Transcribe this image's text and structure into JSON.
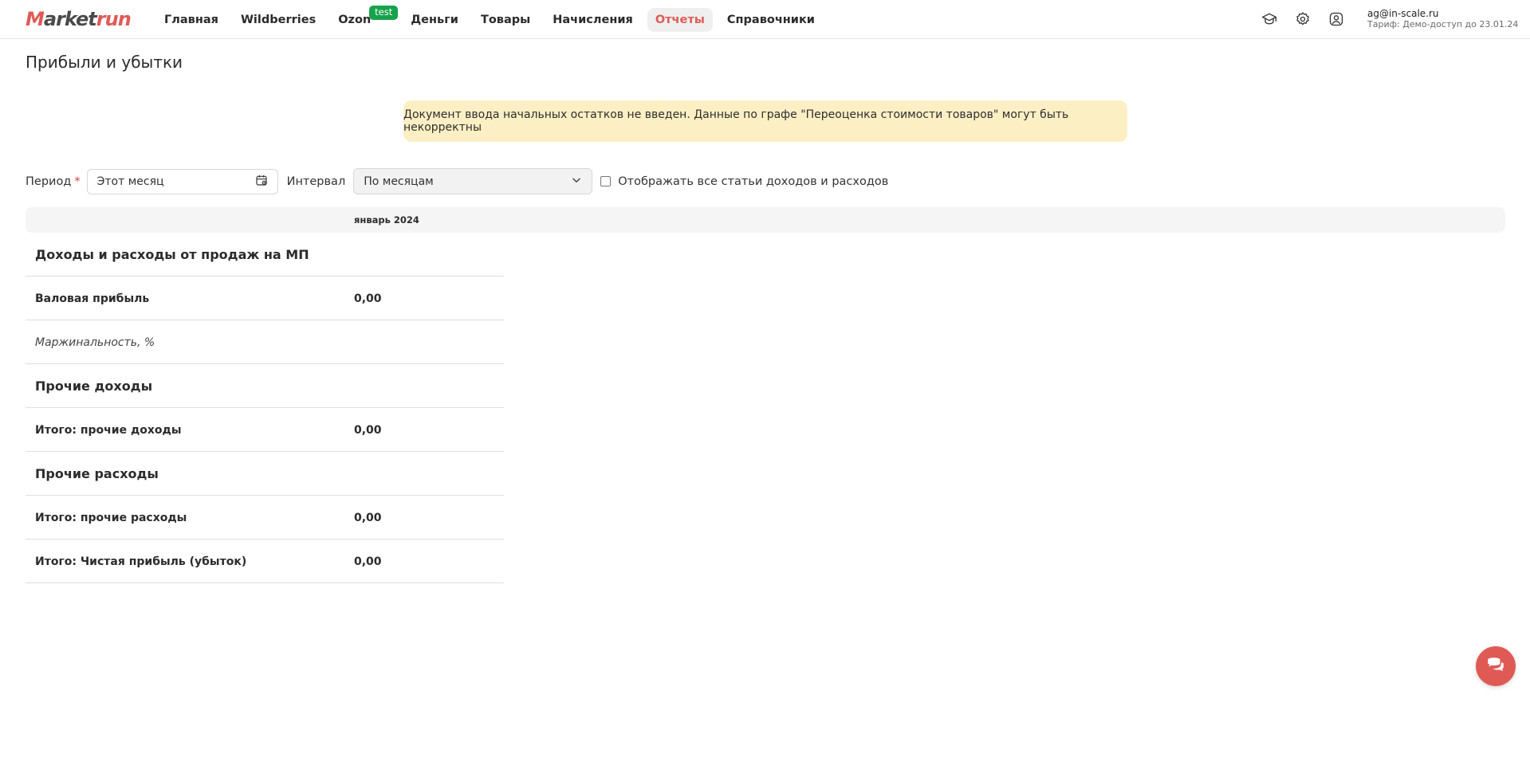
{
  "brand": {
    "logo_text_start": "M",
    "logo_text_mid": "arket",
    "logo_text_end": "run",
    "accent_color": "#e05a55"
  },
  "nav": {
    "items": [
      {
        "label": "Главная"
      },
      {
        "label": "Wildberries"
      },
      {
        "label": "Ozon",
        "badge": "test"
      },
      {
        "label": "Деньги"
      },
      {
        "label": "Товары"
      },
      {
        "label": "Начисления"
      },
      {
        "label": "Отчеты",
        "active": true
      },
      {
        "label": "Справочники"
      }
    ]
  },
  "header_icons": [
    "graduation-cap-icon",
    "gear-icon",
    "user-circle-icon"
  ],
  "user": {
    "email": "ag@in-scale.ru",
    "tariff": "Тариф: Демо-доступ до 23.01.24"
  },
  "page": {
    "title": "Прибыли и убытки"
  },
  "alert": {
    "text": "Документ ввода начальных остатков не введен. Данные по графе \"Переоценка стоимости товаров\" могут быть некорректны",
    "bg_color": "#fdefc4"
  },
  "filters": {
    "period_label": "Период",
    "required_mark": "*",
    "period_value": "Этот месяц",
    "interval_label": "Интервал",
    "interval_value": "По месяцам",
    "show_all_label": "Отображать все статьи доходов и расходов",
    "show_all_checked": false
  },
  "table": {
    "columns": [
      "январь 2024"
    ],
    "rows": [
      {
        "name": "Доходы и расходы от продаж на МП",
        "value": "",
        "style": "section"
      },
      {
        "name": "Валовая прибыль",
        "value": "0,00",
        "style": "bold"
      },
      {
        "name": "Маржинальность, %",
        "value": "",
        "style": "italic"
      },
      {
        "name": "Прочие доходы",
        "value": "",
        "style": "section"
      },
      {
        "name": "Итого: прочие доходы",
        "value": "0,00",
        "style": "bold"
      },
      {
        "name": "Прочие расходы",
        "value": "",
        "style": "section"
      },
      {
        "name": "Итого: прочие расходы",
        "value": "0,00",
        "style": "bold"
      },
      {
        "name": "Итого: Чистая прибыль (убыток)",
        "value": "0,00",
        "style": "bold"
      }
    ]
  },
  "chat": {
    "icon": "chat-bubbles-icon"
  }
}
